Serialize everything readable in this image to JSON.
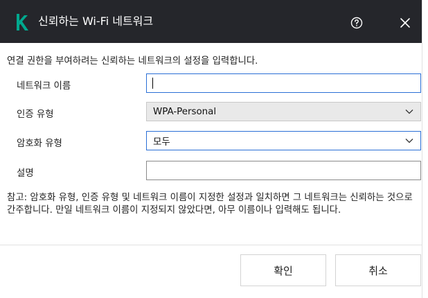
{
  "window": {
    "title": "신뢰하는 Wi-Fi 네트워크",
    "logo_icon": "kaspersky-k-logo",
    "help_icon": "help-circle-icon",
    "close_icon": "close-icon",
    "titlebar_color": "#25262b",
    "logo_color": "#00a88e"
  },
  "form": {
    "intro": "연결 권한을 부여하려는 신뢰하는 네트워크의 설정을 입력합니다.",
    "network_name": {
      "label": "네트워크 이름",
      "value": ""
    },
    "auth_type": {
      "label": "인증 유형",
      "value": "WPA-Personal"
    },
    "encryption_type": {
      "label": "암호화 유형",
      "value": "모두"
    },
    "description": {
      "label": "설명",
      "value": ""
    },
    "note": "참고: 암호화 유형, 인증 유형 및 네트워크 이름이 지정한 설정과 일치하면 그 네트워크는 신뢰하는 것으로 간주합니다. 만일 네트워크 이름이 지정되지 않았다면, 아무 이름이나 입력해도 됩니다."
  },
  "buttons": {
    "ok": "확인",
    "cancel": "취소"
  },
  "colors": {
    "focus_border": "#2a6fd6"
  }
}
